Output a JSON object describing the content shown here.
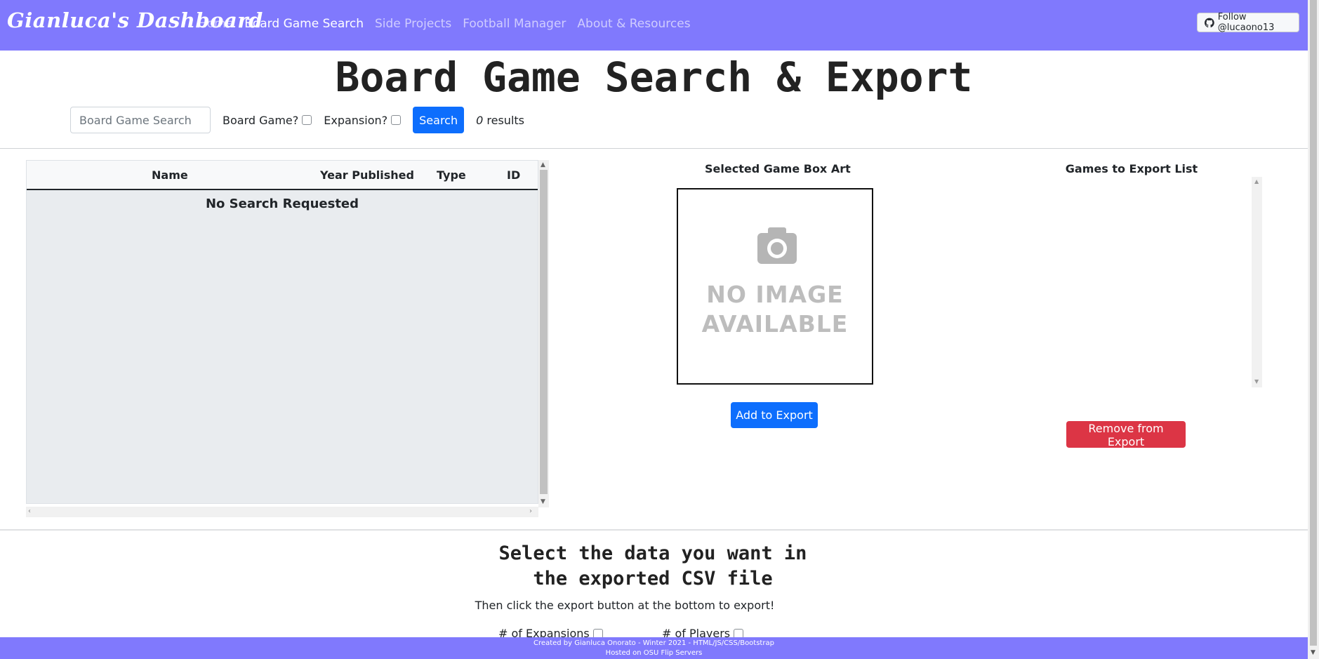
{
  "navbar": {
    "brand": "Gianluca's Dashboard",
    "links": [
      {
        "label": "Home",
        "active": false
      },
      {
        "label": "Board Game Search",
        "active": true
      },
      {
        "label": "Side Projects",
        "active": false
      },
      {
        "label": "Football Manager",
        "active": false
      },
      {
        "label": "About & Resources",
        "active": false
      }
    ],
    "follow_label": "Follow @lucaono13",
    "follow_icon": "github-icon",
    "bg_color": "#8079fd"
  },
  "page_title": "Board Game Search & Export",
  "search": {
    "placeholder": "Board Game Search",
    "value": "",
    "board_game_label": "Board Game?",
    "board_game_checked": false,
    "expansion_label": "Expansion?",
    "expansion_checked": false,
    "button_label": "Search",
    "results_count": "0",
    "results_suffix": " results"
  },
  "table": {
    "columns": [
      "Name",
      "Year Published",
      "Type",
      "ID"
    ],
    "empty_message": "No Search Requested"
  },
  "box_art": {
    "title": "Selected Game Box Art",
    "placeholder_line1": "NO IMAGE",
    "placeholder_line2": "AVAILABLE",
    "add_button": "Add to Export"
  },
  "export_list": {
    "title": "Games to Export List",
    "items": [],
    "remove_button": "Remove from Export"
  },
  "csv_section": {
    "title_line1": "Select the data you want in",
    "title_line2": "the exported CSV file",
    "subtitle": "Then click the export button at the bottom to export!",
    "options": [
      {
        "label": "# of Expansions",
        "checked": false
      },
      {
        "label": "# of Players",
        "checked": false
      }
    ]
  },
  "footer": {
    "line1": "Created by Gianluca Onorato - Winter 2021 - HTML/JS/CSS/Bootstrap",
    "line2": "Hosted on OSU Flip Servers"
  },
  "colors": {
    "primary": "#0d6efd",
    "danger": "#dc3545",
    "navbar": "#8079fd"
  }
}
